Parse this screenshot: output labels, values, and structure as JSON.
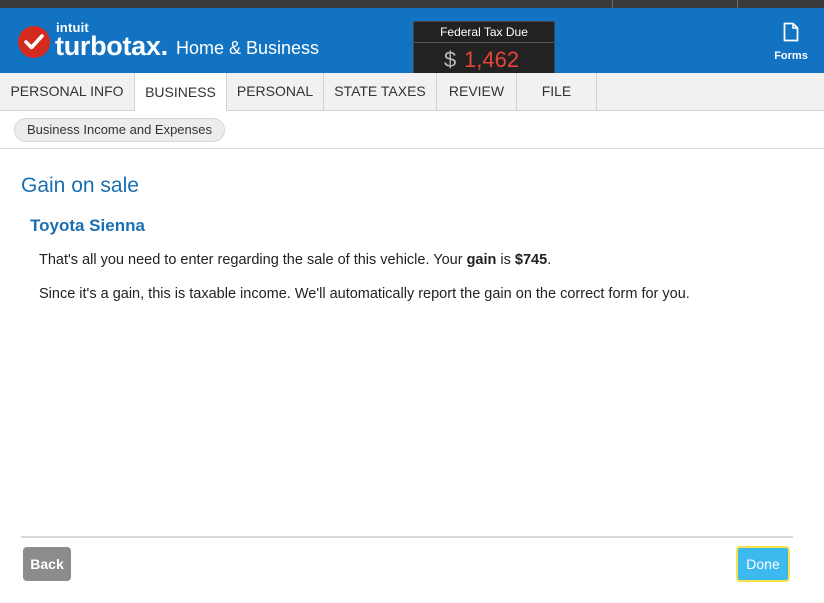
{
  "header": {
    "brand_small": "intuit",
    "brand": "turbotax.",
    "product": "Home & Business",
    "tax_due_label": "Federal Tax Due",
    "tax_due_currency": "$",
    "tax_due_amount": "1,462",
    "forms_label": "Forms"
  },
  "tabs": [
    {
      "label": "PERSONAL INFO"
    },
    {
      "label": "BUSINESS",
      "active": true
    },
    {
      "label": "PERSONAL"
    },
    {
      "label": "STATE TAXES"
    },
    {
      "label": "REVIEW"
    },
    {
      "label": "FILE"
    }
  ],
  "breadcrumb": {
    "label": "Business Income and Expenses"
  },
  "main": {
    "title": "Gain on sale",
    "vehicle": "Toyota Sienna",
    "para1": {
      "pre": "That's all you need to enter regarding the sale of this vehicle. Your ",
      "bold1": "gain",
      "mid": " is ",
      "bold2": "$745",
      "post": "."
    },
    "para2": "Since it's a gain, this is taxable income. We'll automatically report the gain on the correct form for you."
  },
  "footer": {
    "back_label": "Back",
    "done_label": "Done"
  },
  "colors": {
    "header_blue": "#1273c2",
    "title_blue": "#1a6fb2",
    "tax_red": "#e8433a",
    "done_button": "#3cb9ef"
  },
  "icons": {
    "logo": "checkmark-icon",
    "forms": "document-icon"
  }
}
